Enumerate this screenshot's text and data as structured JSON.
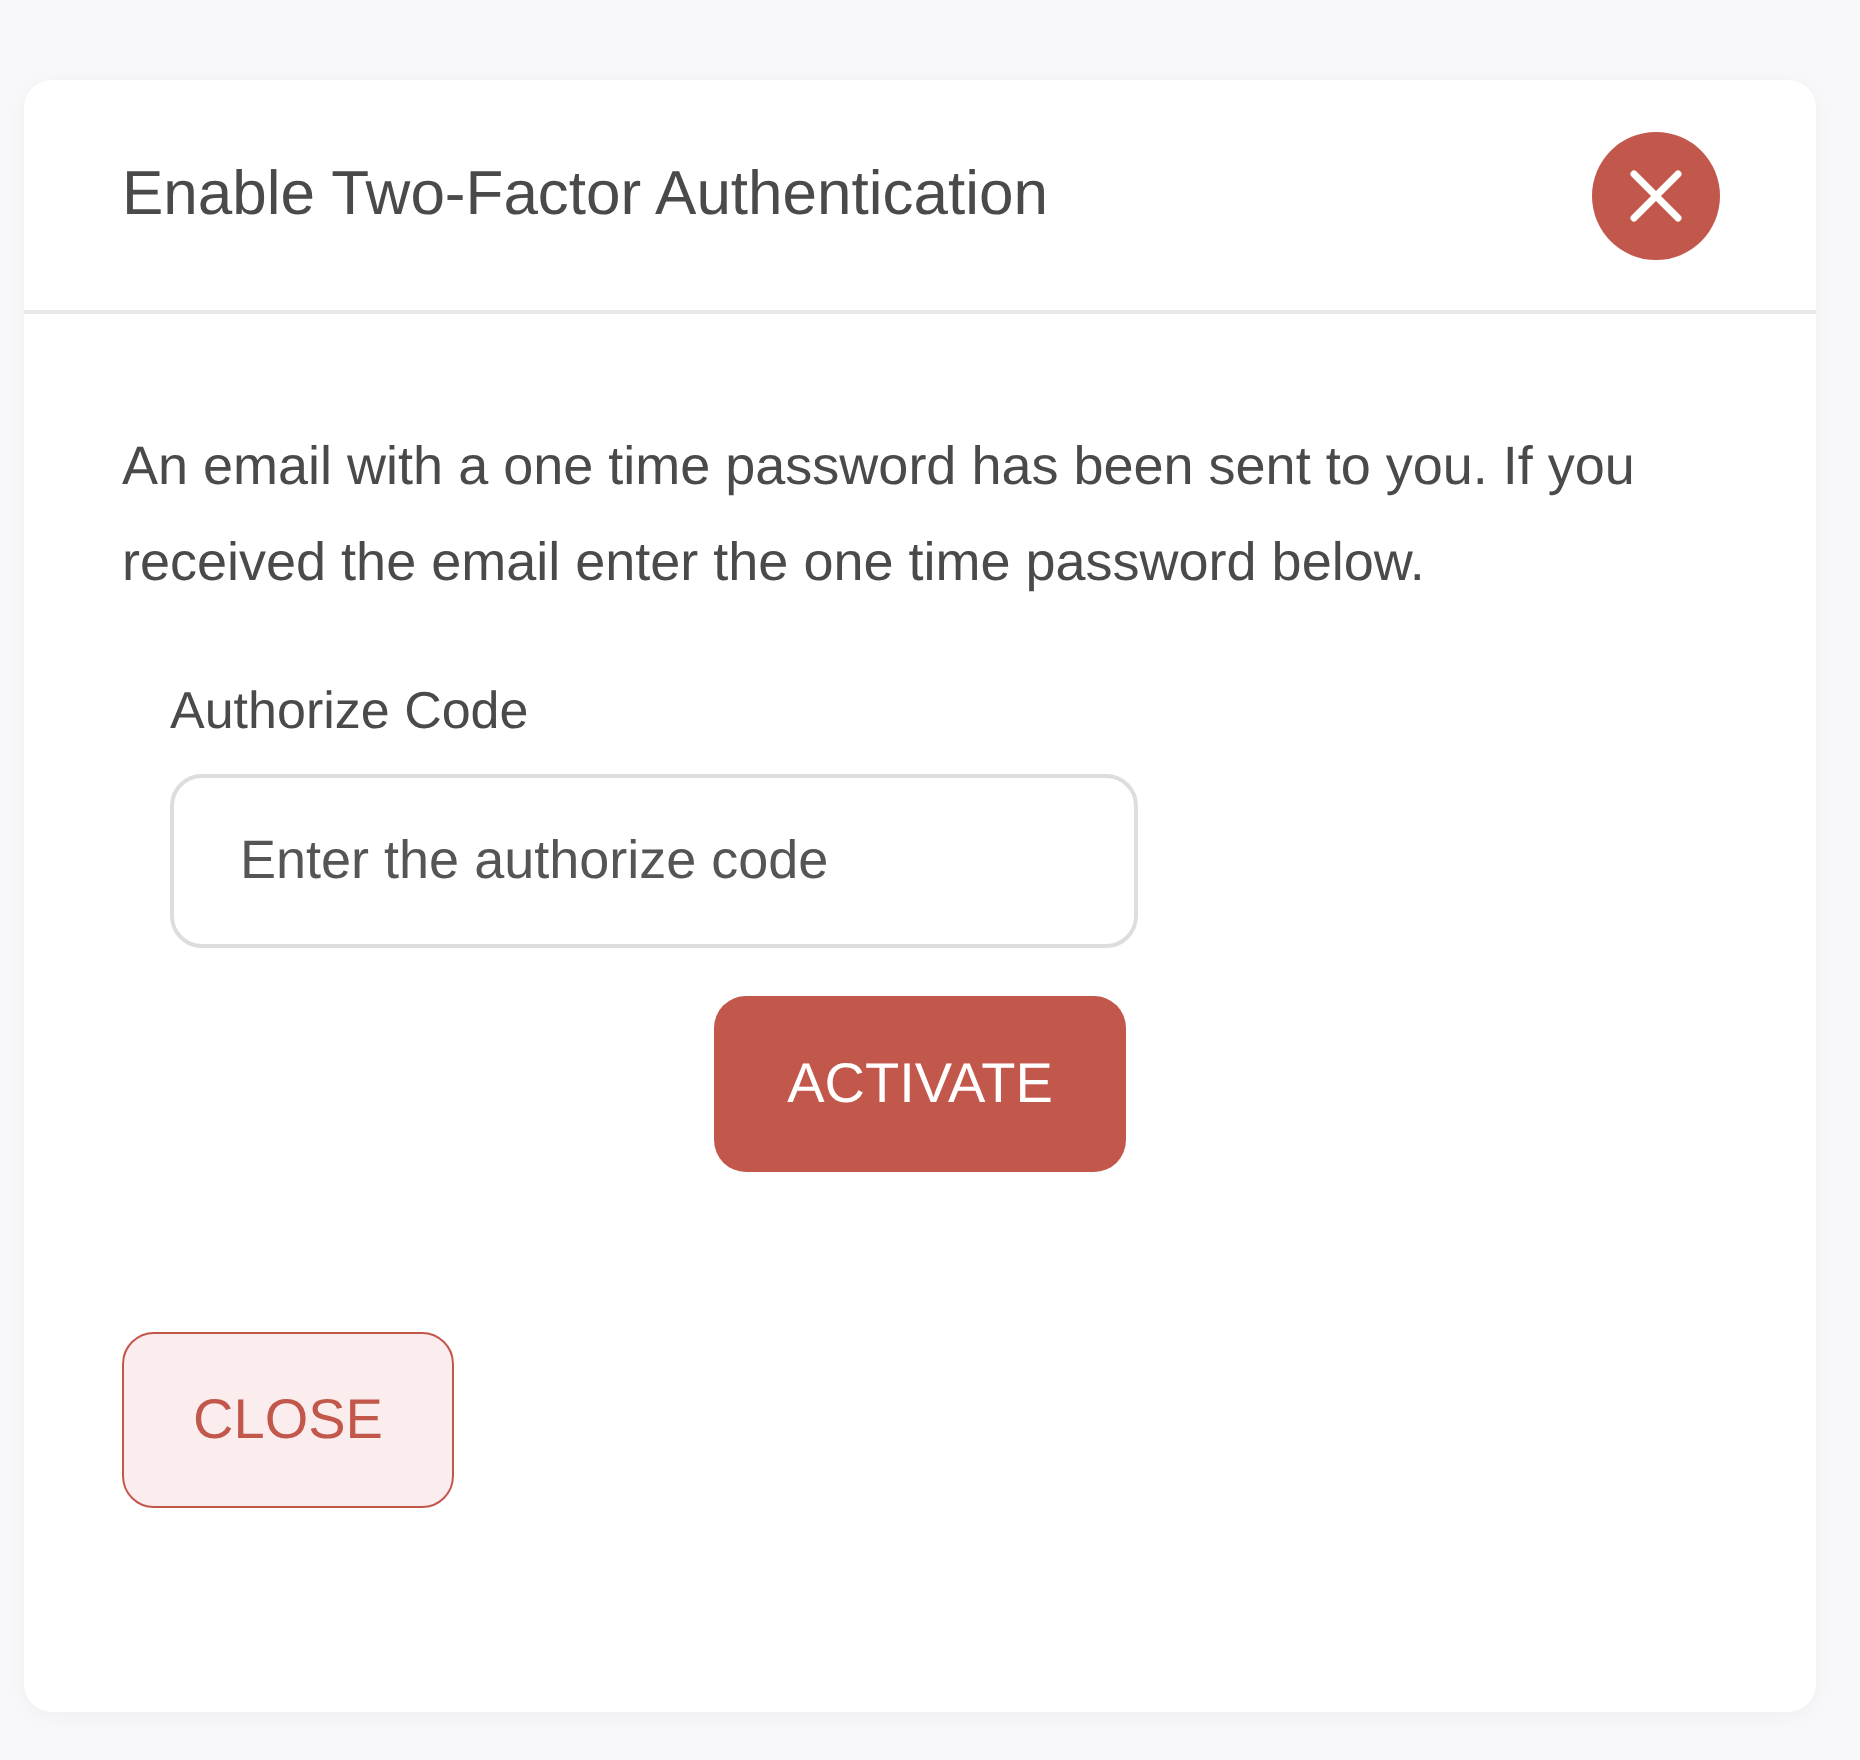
{
  "dialog": {
    "title": "Enable Two-Factor Authentication",
    "message": "An email with a one time password has been sent to you. If you received the email enter the one time password below.",
    "field": {
      "label": "Authorize Code",
      "placeholder": "Enter the authorize code"
    },
    "buttons": [
      {
        "label": "ACTIVATE",
        "kind": "primary"
      },
      {
        "label": "CLOSE",
        "kind": "secondary"
      }
    ]
  }
}
